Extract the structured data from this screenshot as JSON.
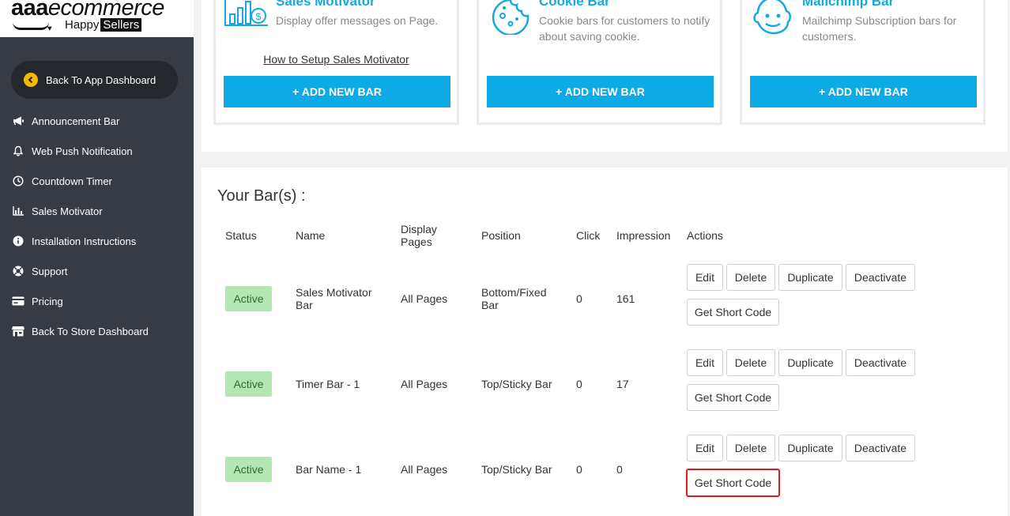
{
  "logo": {
    "main_bold": "aaa",
    "main_rest": "ecommerce",
    "sub_1": "Happy",
    "sub_2": "Sellers"
  },
  "sidebar": {
    "back_app": "Back To App Dashboard",
    "items": [
      {
        "label": "Announcement Bar",
        "icon": "megaphone-icon"
      },
      {
        "label": "Web Push Notification",
        "icon": "bell-icon"
      },
      {
        "label": "Countdown Timer",
        "icon": "clock-icon"
      },
      {
        "label": "Sales Motivator",
        "icon": "bar-chart-icon"
      },
      {
        "label": "Installation Instructions",
        "icon": "info-icon"
      },
      {
        "label": "Support",
        "icon": "lifebuoy-icon"
      },
      {
        "label": "Pricing",
        "icon": "credit-card-icon"
      },
      {
        "label": "Back To Store Dashboard",
        "icon": "store-icon"
      }
    ]
  },
  "cards": [
    {
      "title": "Sales Motivator",
      "desc": "Display offer messages on Page.",
      "howto": "How to Setup Sales Motivator",
      "button": "+ ADD NEW BAR"
    },
    {
      "title": "Cookie Bar",
      "desc": "Cookie bars for customers to notify about saving cookie.",
      "button": "+ ADD NEW BAR"
    },
    {
      "title": "Mailchimp Bar",
      "desc": "Mailchimp Subscription bars for customers.",
      "button": "+ ADD NEW BAR"
    }
  ],
  "bars": {
    "title": "Your Bar(s) :",
    "columns": [
      "Status",
      "Name",
      "Display Pages",
      "Position",
      "Click",
      "Impression",
      "Actions"
    ],
    "action_labels": {
      "edit": "Edit",
      "delete": "Delete",
      "duplicate": "Duplicate",
      "deactivate": "Deactivate",
      "short_code": "Get Short Code"
    },
    "rows": [
      {
        "status": "Active",
        "name": "Sales Motivator Bar",
        "pages": "All Pages",
        "position": "Bottom/Fixed Bar",
        "click": "0",
        "impression": "161"
      },
      {
        "status": "Active",
        "name": "Timer Bar - 1",
        "pages": "All Pages",
        "position": "Top/Sticky Bar",
        "click": "0",
        "impression": "17"
      },
      {
        "status": "Active",
        "name": "Bar Name - 1",
        "pages": "All Pages",
        "position": "Top/Sticky Bar",
        "click": "0",
        "impression": "0"
      }
    ]
  },
  "colors": {
    "sidebar": "#373c44",
    "accent": "#0eaae6",
    "active_badge": "#b4e6b4",
    "highlight": "#e01b1b"
  }
}
